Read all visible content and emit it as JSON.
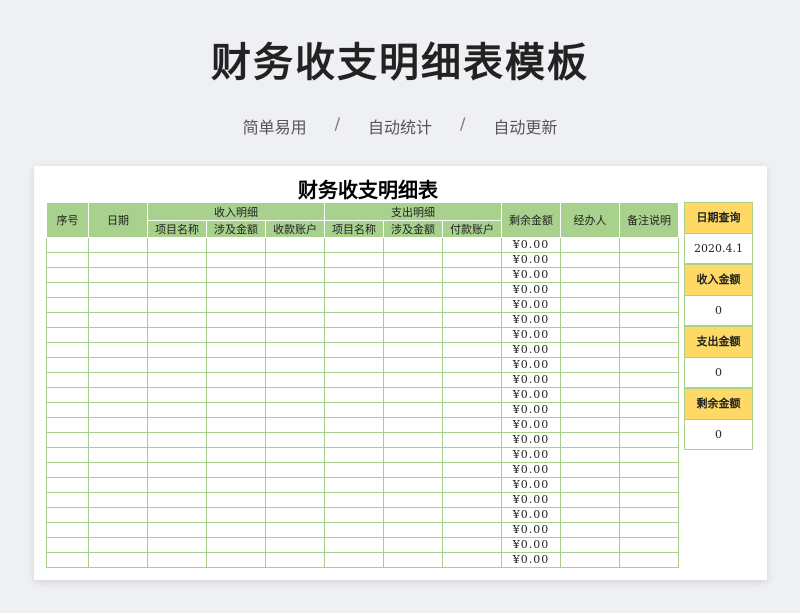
{
  "header": {
    "title": "财务收支明细表模板",
    "features": [
      "简单易用",
      "自动统计",
      "自动更新"
    ],
    "separator": "/"
  },
  "sheet": {
    "title": "财务收支明细表",
    "columns": {
      "index": "序号",
      "date": "日期",
      "income_group": "收入明细",
      "income_item": "项目名称",
      "income_amount": "涉及金额",
      "income_account": "收款账户",
      "expense_group": "支出明细",
      "expense_item": "项目名称",
      "expense_amount": "涉及金额",
      "expense_account": "付款账户",
      "balance": "剩余金额",
      "handler": "经办人",
      "remarks": "备注说明"
    },
    "balance_values": [
      "¥0.00",
      "¥0.00",
      "¥0.00",
      "¥0.00",
      "¥0.00",
      "¥0.00",
      "¥0.00",
      "¥0.00",
      "¥0.00",
      "¥0.00",
      "¥0.00",
      "¥0.00",
      "¥0.00",
      "¥0.00",
      "¥0.00",
      "¥0.00",
      "¥0.00",
      "¥0.00",
      "¥0.00",
      "¥0.00",
      "¥0.00",
      "¥0.00"
    ]
  },
  "summary": {
    "date_query_label": "日期查询",
    "date_query_value": "2020.4.1",
    "income_label": "收入金额",
    "income_value": "0",
    "expense_label": "支出金额",
    "expense_value": "0",
    "remaining_label": "剩余金额",
    "remaining_value": "0"
  },
  "colors": {
    "header_green": "#a9d18e",
    "summary_yellow": "#ffd966"
  }
}
